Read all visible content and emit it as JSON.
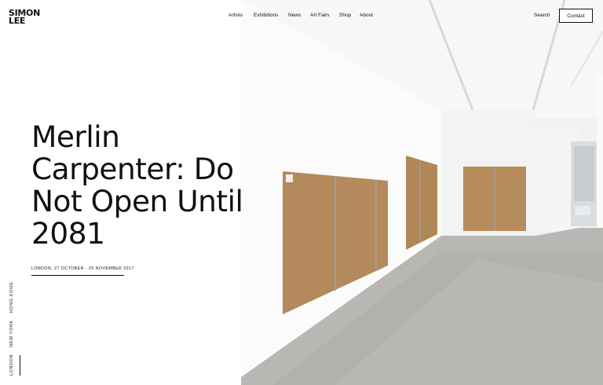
{
  "brand": {
    "line1": "SIMON",
    "line2": "LEE"
  },
  "nav": {
    "items": [
      "Artists",
      "Exhibitions",
      "News",
      "Art Fairs",
      "Shop",
      "About"
    ],
    "search_label": "Search",
    "contact_label": "Contact"
  },
  "exhibition": {
    "title": "Merlin Carpenter: Do Not Open Until 2081",
    "dates": "LONDON,  27 OCTOBER - 25 NOVEMBER 2017"
  },
  "locations": {
    "items": [
      "LONDON",
      "NEW YORK",
      "HONG KONG"
    ],
    "active": "LONDON"
  },
  "colors": {
    "text": "#111111",
    "background": "#ffffff",
    "cardboard": "#b48a5c"
  }
}
